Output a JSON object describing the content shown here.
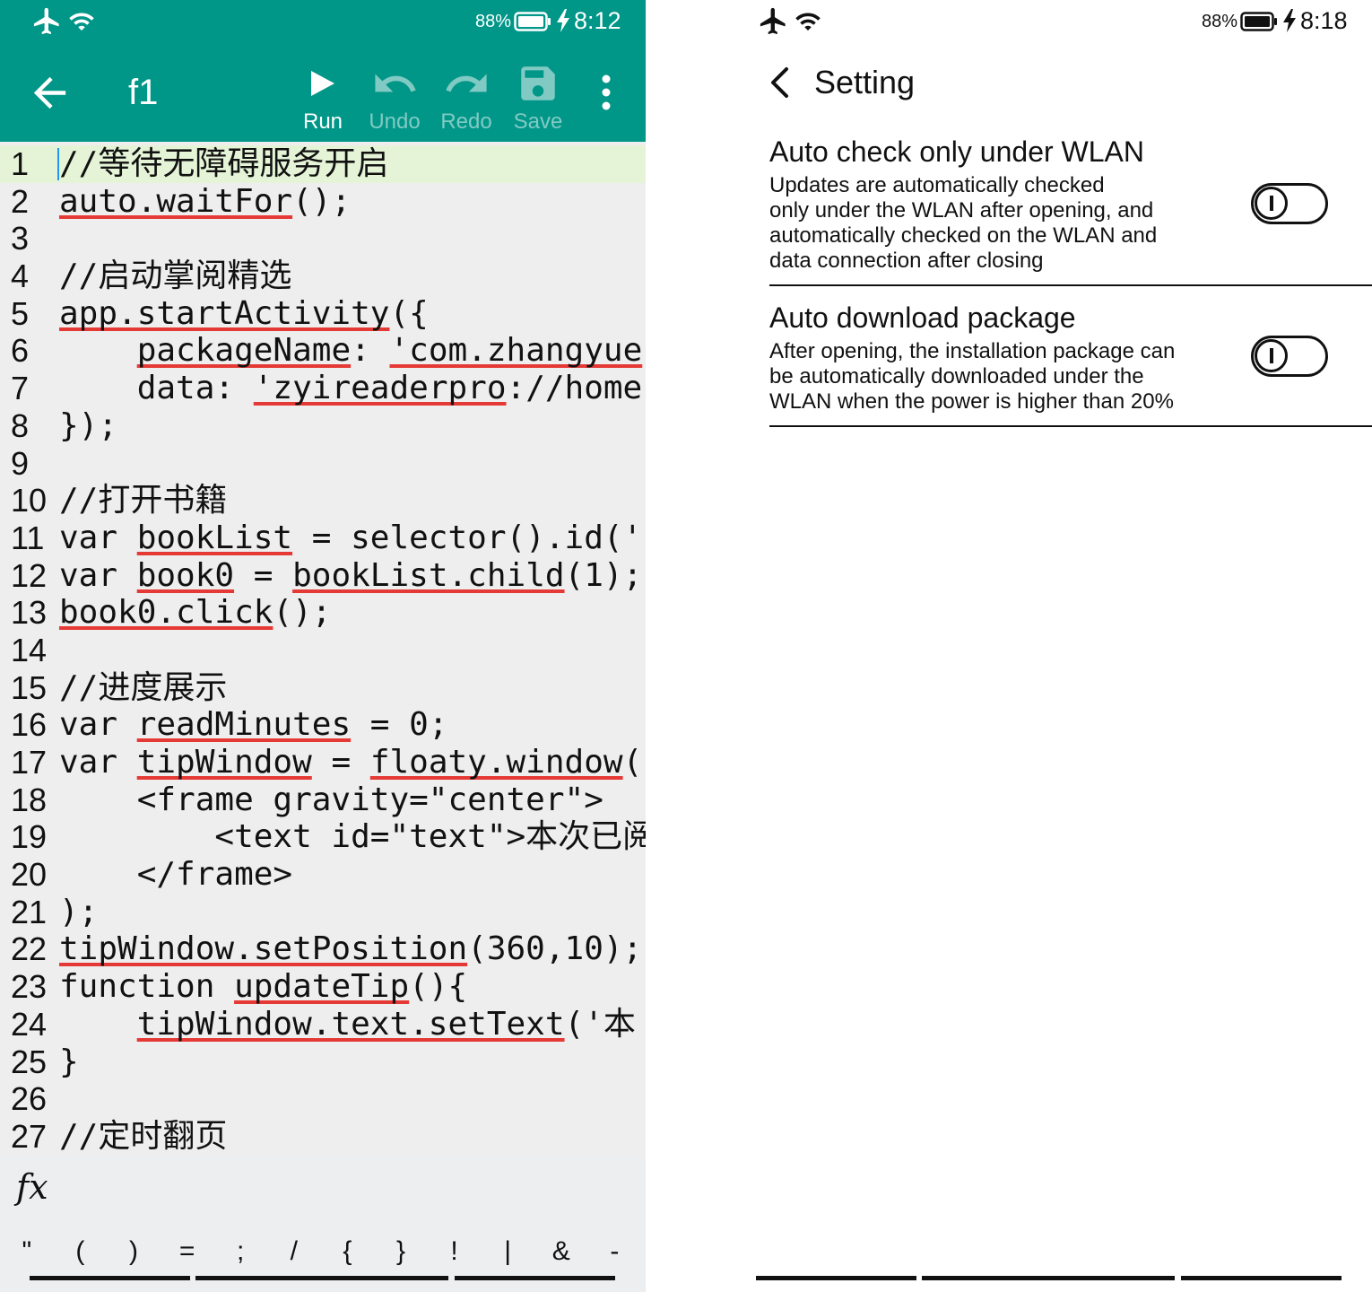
{
  "left": {
    "status_bar": {
      "battery_percent": "88%",
      "time": "8:12"
    },
    "toolbar": {
      "title": "f1",
      "actions": [
        {
          "label": "Run",
          "icon": "play-icon",
          "enabled": true
        },
        {
          "label": "Undo",
          "icon": "undo-icon",
          "enabled": false
        },
        {
          "label": "Redo",
          "icon": "redo-icon",
          "enabled": false
        },
        {
          "label": "Save",
          "icon": "save-icon",
          "enabled": false
        }
      ]
    },
    "editor": {
      "current_line": 1,
      "lines": [
        {
          "num": "1",
          "segments": [
            {
              "text": "//等待无障碍服务开启"
            }
          ]
        },
        {
          "num": "2",
          "segments": [
            {
              "text": "auto.waitFor",
              "underlined": true
            },
            {
              "text": "();"
            }
          ]
        },
        {
          "num": "3",
          "segments": []
        },
        {
          "num": "4",
          "segments": [
            {
              "text": "//启动掌阅精选"
            }
          ]
        },
        {
          "num": "5",
          "segments": [
            {
              "text": "app.startActivity",
              "underlined": true
            },
            {
              "text": "({"
            }
          ]
        },
        {
          "num": "6",
          "segments": [
            {
              "text": "    "
            },
            {
              "text": "packageName",
              "underlined": true
            },
            {
              "text": ": "
            },
            {
              "text": "'com.zhangyue",
              "underlined": true
            }
          ]
        },
        {
          "num": "7",
          "segments": [
            {
              "text": "    data: "
            },
            {
              "text": "'zyireaderpro",
              "underlined": true
            },
            {
              "text": "://home"
            }
          ]
        },
        {
          "num": "8",
          "segments": [
            {
              "text": "});"
            }
          ]
        },
        {
          "num": "9",
          "segments": []
        },
        {
          "num": "10",
          "segments": [
            {
              "text": "//打开书籍"
            }
          ]
        },
        {
          "num": "11",
          "segments": [
            {
              "text": "var "
            },
            {
              "text": "bookList",
              "underlined": true
            },
            {
              "text": " = selector().id('"
            }
          ]
        },
        {
          "num": "12",
          "segments": [
            {
              "text": "var "
            },
            {
              "text": "book0",
              "underlined": true
            },
            {
              "text": " = "
            },
            {
              "text": "bookList.child",
              "underlined": true
            },
            {
              "text": "(1);"
            }
          ]
        },
        {
          "num": "13",
          "segments": [
            {
              "text": "book0.click",
              "underlined": true
            },
            {
              "text": "();"
            }
          ]
        },
        {
          "num": "14",
          "segments": []
        },
        {
          "num": "15",
          "segments": [
            {
              "text": "//进度展示"
            }
          ]
        },
        {
          "num": "16",
          "segments": [
            {
              "text": "var "
            },
            {
              "text": "readMinutes",
              "underlined": true
            },
            {
              "text": " = 0;"
            }
          ]
        },
        {
          "num": "17",
          "segments": [
            {
              "text": "var "
            },
            {
              "text": "tipWindow",
              "underlined": true
            },
            {
              "text": " = "
            },
            {
              "text": "floaty.window",
              "underlined": true
            },
            {
              "text": "("
            }
          ]
        },
        {
          "num": "18",
          "segments": [
            {
              "text": "    <frame gravity=\"center\">"
            }
          ]
        },
        {
          "num": "19",
          "segments": [
            {
              "text": "        <text id=\"text\">本次已阅"
            }
          ]
        },
        {
          "num": "20",
          "segments": [
            {
              "text": "    </frame>"
            }
          ]
        },
        {
          "num": "21",
          "segments": [
            {
              "text": ");"
            }
          ]
        },
        {
          "num": "22",
          "segments": [
            {
              "text": "tipWindow.setPosition",
              "underlined": true
            },
            {
              "text": "(360,10);"
            }
          ]
        },
        {
          "num": "23",
          "segments": [
            {
              "text": "function "
            },
            {
              "text": "updateTip",
              "underlined": true
            },
            {
              "text": "(){"
            }
          ]
        },
        {
          "num": "24",
          "segments": [
            {
              "text": "    "
            },
            {
              "text": "tipWindow.text.setText",
              "underlined": true
            },
            {
              "text": "('本"
            }
          ]
        },
        {
          "num": "25",
          "segments": [
            {
              "text": "}"
            }
          ]
        },
        {
          "num": "26",
          "segments": []
        },
        {
          "num": "27",
          "segments": [
            {
              "text": "//定时翻页"
            }
          ]
        }
      ]
    },
    "function_button": "fx",
    "symbol_bar": {
      "keys": [
        "\"",
        "(",
        ")",
        "=",
        ";",
        "/",
        "{",
        "}",
        "!",
        "|",
        "&",
        "-"
      ]
    }
  },
  "right": {
    "status_bar": {
      "battery_percent": "88%",
      "time": "8:18"
    },
    "header": {
      "title": "Setting"
    },
    "settings": [
      {
        "title": "Auto check only under WLAN",
        "description": [
          "Updates are automatically checked",
          "only under the WLAN after opening, and",
          "automatically checked on the WLAN and",
          "data connection after closing"
        ],
        "enabled": false
      },
      {
        "title": "Auto download package",
        "description": [
          "After opening, the installation package can",
          "be automatically downloaded under the",
          "WLAN when the power is higher than 20%"
        ],
        "enabled": false
      }
    ]
  },
  "colors": {
    "toolbar": "#009688",
    "editor_bg": "#EEEEEE",
    "current_line": "#E5F4D7",
    "bottom_bar": "#ECEEEF",
    "lint_underline": "#E53935",
    "cursor": "#2196F3",
    "text": "#111111"
  }
}
